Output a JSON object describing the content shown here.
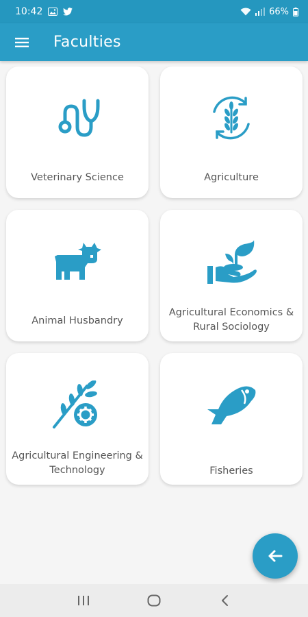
{
  "status": {
    "time": "10:42",
    "battery": "66%"
  },
  "app_bar": {
    "title": "Faculties"
  },
  "faculties": [
    {
      "label": "Veterinary Science",
      "icon": "stethoscope-icon"
    },
    {
      "label": "Agriculture",
      "icon": "wheat-cycle-icon"
    },
    {
      "label": "Animal Husbandry",
      "icon": "cow-icon"
    },
    {
      "label": "Agricultural Economics & Rural Sociology",
      "icon": "hand-plant-icon"
    },
    {
      "label": "Agricultural Engineering & Technology",
      "icon": "wheat-gear-icon"
    },
    {
      "label": "Fisheries",
      "icon": "fish-icon"
    }
  ],
  "colors": {
    "primary": "#2a9dc6",
    "status_bar": "#2597bf",
    "icon": "#2a9dc6",
    "label_text": "#555555",
    "background": "#f5f5f5"
  }
}
